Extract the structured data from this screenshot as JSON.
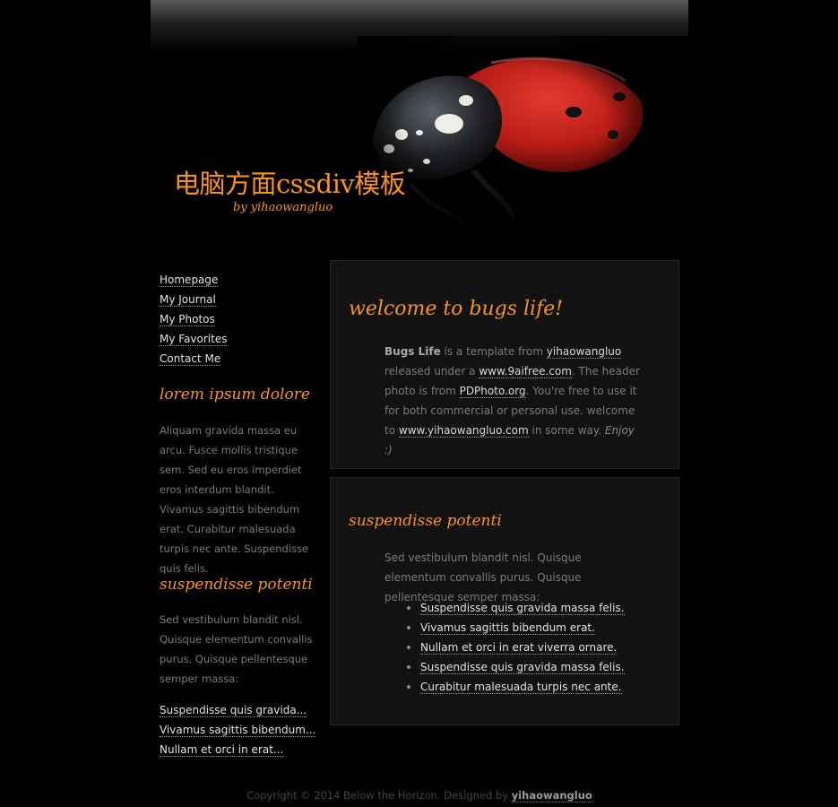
{
  "header": {
    "site_title": "电脑方面cssdiv模板",
    "site_subtitle": "by yihaowangluo"
  },
  "nav": [
    {
      "label": "Homepage"
    },
    {
      "label": "My Journal"
    },
    {
      "label": "My Photos"
    },
    {
      "label": "My Favorites"
    },
    {
      "label": "Contact Me"
    }
  ],
  "sidebar": {
    "section1": {
      "title": "lorem ipsum dolore",
      "text": "Aliquam gravida massa eu arcu. Fusce mollis tristique sem. Sed eu eros imperdiet eros interdum blandit. Vivamus sagittis bibendum erat. Curabitur malesuada turpis nec ante. Suspendisse quis felis."
    },
    "section2": {
      "title": "suspendisse potenti",
      "text": "Sed vestibulum blandit nisl. Quisque elementum convallis purus. Quisque pellentesque semper massa:",
      "links": [
        {
          "label": "Suspendisse quis gravida..."
        },
        {
          "label": "Vivamus sagittis bibendum..."
        },
        {
          "label": "Nullam et orci in erat..."
        }
      ]
    }
  },
  "main": {
    "box1": {
      "title": "welcome to bugs life!",
      "bold": "Bugs Life",
      "t1": " is a template from ",
      "link1": "yihaowangluo",
      "t2": " released under a ",
      "link2": "www.9aifree.com",
      "t3": ". The header photo is from ",
      "link3": "PDPhoto.org",
      "t4": ". You're free to use it for both commercial or personal use. welcome to ",
      "link4": "www.yihaowangluo.com",
      "t5": " in some way. ",
      "enjoy": "Enjoy :)"
    },
    "box2": {
      "title": "suspendisse potenti",
      "text": "Sed vestibulum blandit nisl. Quisque elementum convallis purus. Quisque pellentesque semper massa:",
      "items": [
        {
          "label": "Suspendisse quis gravida massa felis."
        },
        {
          "label": "Vivamus sagittis bibendum erat."
        },
        {
          "label": "Nullam et orci in erat viverra ornare."
        },
        {
          "label": "Suspendisse quis gravida massa felis."
        },
        {
          "label": "Curabitur malesuada turpis nec ante."
        }
      ]
    }
  },
  "footer": {
    "text": "Copyright © 2014 Below the Horizon. Designed by ",
    "link": "yihaowangluo"
  },
  "colors": {
    "accent": "#f7931e",
    "background": "#000000",
    "box_bg": "#121212",
    "ladybug_red": "#c8231c"
  }
}
